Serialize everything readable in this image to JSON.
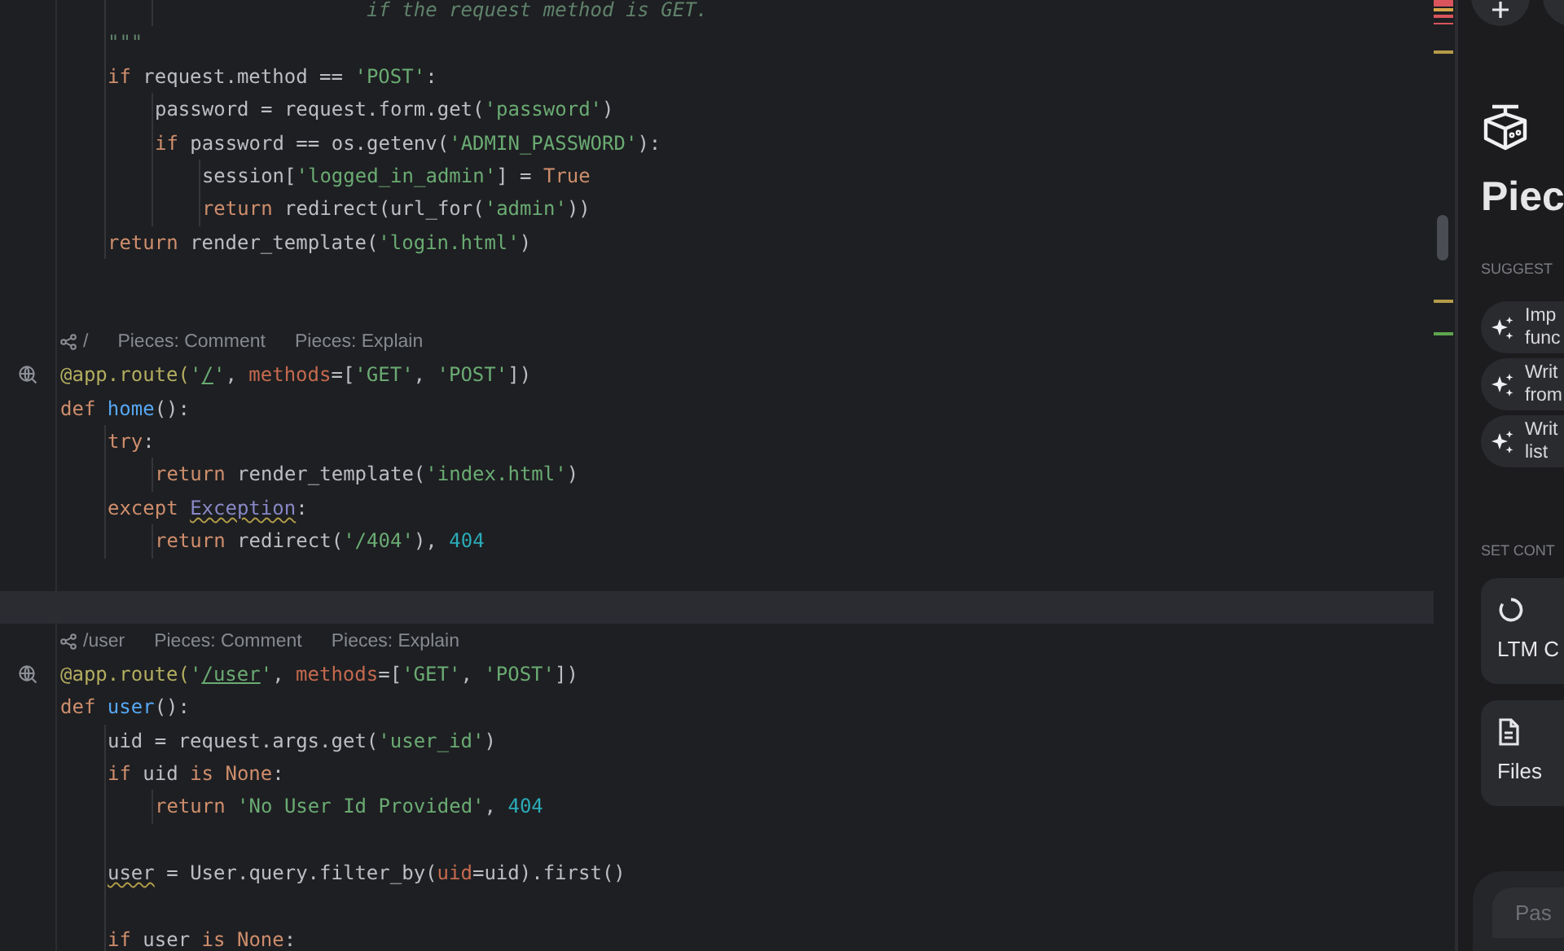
{
  "editor": {
    "lines": [
      {
        "kind": "code",
        "children": [
          {
            "kind": "code",
            "children": [
              {
                "kind": "code",
                "tokens": [
                  {
                    "kind": "doc",
                    "text": "                  if the request method is GET."
                  }
                ]
              }
            ]
          },
          {
            "kind": "code",
            "tokens": [
              {
                "kind": "doc",
                "text": "\"\"\""
              }
            ]
          },
          {
            "kind": "code",
            "tokens": [
              {
                "kind": "kw",
                "text": "if"
              },
              {
                "kind": "plain",
                "text": " request.method == "
              },
              {
                "kind": "str",
                "text": "'POST'"
              },
              {
                "kind": "plain",
                "text": ":"
              }
            ],
            "children": [
              {
                "kind": "code",
                "tokens": [
                  {
                    "kind": "plain",
                    "text": "password = request.form.get("
                  },
                  {
                    "kind": "str",
                    "text": "'password'"
                  },
                  {
                    "kind": "plain",
                    "text": ")"
                  }
                ]
              },
              {
                "kind": "code",
                "tokens": [
                  {
                    "kind": "kw",
                    "text": "if"
                  },
                  {
                    "kind": "plain",
                    "text": " password == os.getenv("
                  },
                  {
                    "kind": "str",
                    "text": "'ADMIN_PASSWORD'"
                  },
                  {
                    "kind": "plain",
                    "text": "):"
                  }
                ],
                "children": [
                  {
                    "kind": "code",
                    "tokens": [
                      {
                        "kind": "plain",
                        "text": "session["
                      },
                      {
                        "kind": "str",
                        "text": "'logged_in_admin'"
                      },
                      {
                        "kind": "plain",
                        "text": "] = "
                      },
                      {
                        "kind": "kw",
                        "text": "True"
                      }
                    ]
                  },
                  {
                    "kind": "code",
                    "tokens": [
                      {
                        "kind": "kw",
                        "text": "return"
                      },
                      {
                        "kind": "plain",
                        "text": " redirect(url_for("
                      },
                      {
                        "kind": "str",
                        "text": "'admin'"
                      },
                      {
                        "kind": "plain",
                        "text": "))"
                      }
                    ]
                  }
                ]
              }
            ]
          },
          {
            "kind": "code",
            "tokens": [
              {
                "kind": "kw",
                "text": "return"
              },
              {
                "kind": "plain",
                "text": " render_template("
              },
              {
                "kind": "str",
                "text": "'login.html'"
              },
              {
                "kind": "plain",
                "text": ")"
              }
            ]
          }
        ]
      },
      {
        "kind": "blank"
      },
      {
        "kind": "blank"
      },
      {
        "kind": "lens",
        "path": "/",
        "actions": [
          "Pieces: Comment",
          "Pieces: Explain"
        ]
      },
      {
        "kind": "code",
        "gutter_icon": true,
        "tokens": [
          {
            "kind": "deco",
            "text": "@app.route("
          },
          {
            "kind": "str",
            "text": "'"
          },
          {
            "kind": "str",
            "text": "/",
            "underlined": true
          },
          {
            "kind": "str",
            "text": "'"
          },
          {
            "kind": "plain",
            "text": ", "
          },
          {
            "kind": "param",
            "text": "methods"
          },
          {
            "kind": "plain",
            "text": "=["
          },
          {
            "kind": "str",
            "text": "'GET'"
          },
          {
            "kind": "plain",
            "text": ", "
          },
          {
            "kind": "str",
            "text": "'POST'"
          },
          {
            "kind": "plain",
            "text": "])"
          }
        ]
      },
      {
        "kind": "code",
        "tokens": [
          {
            "kind": "kw",
            "text": "def "
          },
          {
            "kind": "fn",
            "text": "home"
          },
          {
            "kind": "plain",
            "text": "():"
          }
        ],
        "children": [
          {
            "kind": "code",
            "tokens": [
              {
                "kind": "kw",
                "text": "try"
              },
              {
                "kind": "plain",
                "text": ":"
              }
            ],
            "children": [
              {
                "kind": "code",
                "tokens": [
                  {
                    "kind": "kw",
                    "text": "return"
                  },
                  {
                    "kind": "plain",
                    "text": " render_template("
                  },
                  {
                    "kind": "str",
                    "text": "'index.html'"
                  },
                  {
                    "kind": "plain",
                    "text": ")"
                  }
                ]
              }
            ]
          },
          {
            "kind": "code",
            "tokens": [
              {
                "kind": "kw",
                "text": "except "
              },
              {
                "kind": "cls",
                "text": "Exception",
                "warning": true
              },
              {
                "kind": "plain",
                "text": ":"
              }
            ],
            "children": [
              {
                "kind": "code",
                "tokens": [
                  {
                    "kind": "kw",
                    "text": "return"
                  },
                  {
                    "kind": "plain",
                    "text": " redirect("
                  },
                  {
                    "kind": "str",
                    "text": "'/404'"
                  },
                  {
                    "kind": "plain",
                    "text": "), "
                  },
                  {
                    "kind": "num",
                    "text": "404"
                  }
                ]
              }
            ]
          }
        ]
      },
      {
        "kind": "blank"
      },
      {
        "kind": "blank",
        "current": true
      },
      {
        "kind": "lens",
        "path": "/user",
        "actions": [
          "Pieces: Comment",
          "Pieces: Explain"
        ]
      },
      {
        "kind": "code",
        "gutter_icon": true,
        "tokens": [
          {
            "kind": "deco",
            "text": "@app.route("
          },
          {
            "kind": "str",
            "text": "'"
          },
          {
            "kind": "str",
            "text": "/user",
            "underlined": true
          },
          {
            "kind": "str",
            "text": "'"
          },
          {
            "kind": "plain",
            "text": ", "
          },
          {
            "kind": "param",
            "text": "methods"
          },
          {
            "kind": "plain",
            "text": "=["
          },
          {
            "kind": "str",
            "text": "'GET'"
          },
          {
            "kind": "plain",
            "text": ", "
          },
          {
            "kind": "str",
            "text": "'POST'"
          },
          {
            "kind": "plain",
            "text": "])"
          }
        ]
      },
      {
        "kind": "code",
        "tokens": [
          {
            "kind": "kw",
            "text": "def "
          },
          {
            "kind": "fn",
            "text": "user"
          },
          {
            "kind": "plain",
            "text": "():"
          }
        ],
        "children": [
          {
            "kind": "code",
            "tokens": [
              {
                "kind": "plain",
                "text": "uid = request.args.get("
              },
              {
                "kind": "str",
                "text": "'user_id'"
              },
              {
                "kind": "plain",
                "text": ")"
              }
            ]
          },
          {
            "kind": "code",
            "tokens": [
              {
                "kind": "kw",
                "text": "if"
              },
              {
                "kind": "plain",
                "text": " uid "
              },
              {
                "kind": "kw",
                "text": "is None"
              },
              {
                "kind": "plain",
                "text": ":"
              }
            ],
            "children": [
              {
                "kind": "code",
                "tokens": [
                  {
                    "kind": "kw",
                    "text": "return "
                  },
                  {
                    "kind": "str",
                    "text": "'No User Id Provided'"
                  },
                  {
                    "kind": "plain",
                    "text": ", "
                  },
                  {
                    "kind": "num",
                    "text": "404"
                  }
                ]
              }
            ]
          },
          {
            "kind": "blank"
          },
          {
            "kind": "code",
            "tokens": [
              {
                "kind": "plain",
                "text": "user",
                "warning": true
              },
              {
                "kind": "plain",
                "text": " = User.query.filter_by("
              },
              {
                "kind": "param",
                "text": "uid"
              },
              {
                "kind": "plain",
                "text": "=uid).first()"
              }
            ]
          },
          {
            "kind": "blank"
          },
          {
            "kind": "code",
            "tokens": [
              {
                "kind": "kw",
                "text": "if"
              },
              {
                "kind": "plain",
                "text": " user "
              },
              {
                "kind": "kw",
                "text": "is None"
              },
              {
                "kind": "plain",
                "text": ":"
              }
            ]
          }
        ]
      }
    ]
  },
  "panel": {
    "title": "Piec",
    "suggested_heading": "SUGGEST",
    "suggestions": [
      {
        "lines": [
          "Imp",
          "func"
        ]
      },
      {
        "lines": [
          "Writ",
          "from"
        ]
      },
      {
        "lines": [
          "Writ",
          "list"
        ]
      }
    ],
    "context_heading": "SET CONT",
    "context_cards": [
      {
        "kind": "ltm",
        "label": "LTM C"
      },
      {
        "kind": "files",
        "label": "Files"
      }
    ],
    "input": {
      "placeholder": "Pas"
    }
  }
}
